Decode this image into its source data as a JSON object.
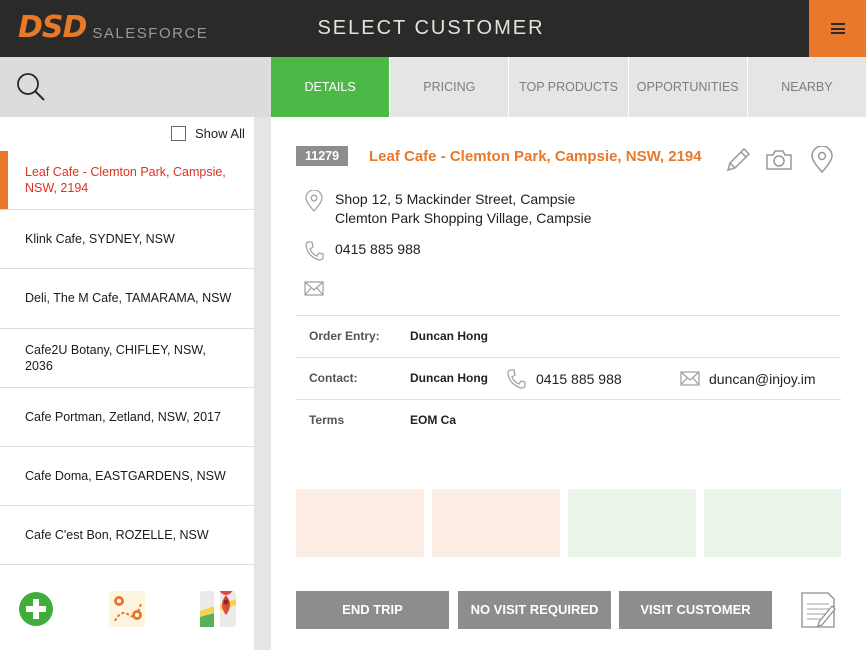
{
  "header": {
    "logo_mark": "DSD",
    "logo_sub": "SALESFORCE",
    "title": "SELECT CUSTOMER",
    "menu_icon": "hamburger-icon",
    "accent": "#e8782a",
    "bg": "#2b2a29"
  },
  "tabs": [
    {
      "label": "DETAILS",
      "active": true
    },
    {
      "label": "PRICING",
      "active": false
    },
    {
      "label": "TOP PRODUCTS",
      "active": false
    },
    {
      "label": "OPPORTUNITIES",
      "active": false
    },
    {
      "label": "NEARBY",
      "active": false
    }
  ],
  "tab_active_color": "#4cb946",
  "sidebar": {
    "search_icon": "search-icon",
    "show_all_label": "Show All",
    "show_all_checked": false,
    "customers": [
      "Leaf Cafe - Clemton Park, Campsie, NSW, 2194",
      "Klink Cafe, SYDNEY, NSW",
      "Deli, The M Cafe, TAMARAMA, NSW",
      "Cafe2U Botany, CHIFLEY, NSW, 2036",
      "Cafe Portman, Zetland, NSW, 2017",
      "Cafe Doma, EASTGARDENS, NSW",
      "Cafe C'est Bon, ROZELLE, NSW"
    ],
    "active_index": 0,
    "actions": [
      "add-customer-icon",
      "route-map-icon",
      "google-maps-icon"
    ]
  },
  "detail": {
    "account_no": "11279",
    "name": "Leaf Cafe - Clemton Park, Campsie, NSW, 2194",
    "header_icons": [
      "edit-icon",
      "camera-icon",
      "location-pin-icon"
    ],
    "address_line1": "Shop 12, 5 Mackinder Street, Campsie",
    "address_line2": "Clemton Park Shopping Village, Campsie",
    "phone": "0415 885 988",
    "order_entry": {
      "label": "Order Entry:",
      "value": "Duncan Hong"
    },
    "contact": {
      "label": "Contact:",
      "name": "Duncan Hong",
      "phone": "0415 885 988",
      "email": "duncan@injoy.im"
    },
    "terms": {
      "label": "Terms",
      "value": "EOM Ca"
    },
    "tile_colors": [
      "#fbede3",
      "#fbede3",
      "#e8f5e8",
      "#e8f5e8"
    ]
  },
  "footer_buttons": {
    "end_trip": "END TRIP",
    "no_visit": "NO VISIT REQUIRED",
    "visit": "VISIT CUSTOMER",
    "notes_icon": "notes-icon"
  }
}
